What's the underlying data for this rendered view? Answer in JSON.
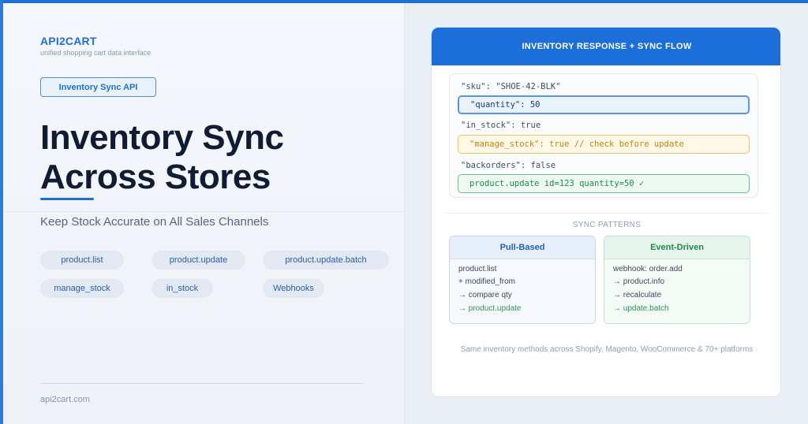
{
  "brand": {
    "name": "API2CART",
    "tagline": "unified shopping cart data interface"
  },
  "badge": "Inventory Sync API",
  "headline": {
    "line1": "Inventory Sync",
    "line2": "Across Stores"
  },
  "subtitle": "Keep Stock Accurate on All Sales Channels",
  "methods": [
    "product.list",
    "product.update",
    "product.update.batch",
    "manage_stock",
    "in_stock",
    "Webhooks"
  ],
  "footer_url": "api2cart.com",
  "card": {
    "title": "INVENTORY RESPONSE + SYNC FLOW",
    "code": {
      "sku": "\"sku\": \"SHOE-42-BLK\"",
      "quantity": "\"quantity\": 50",
      "in_stock": "\"in_stock\": true",
      "manage_stock": "\"manage_stock\": true // check before update",
      "backorders": "\"backorders\": false",
      "update_call": "product.update id=123 quantity=50 ✓"
    },
    "patterns_title": "SYNC PATTERNS",
    "patterns": [
      {
        "title": "Pull-Based",
        "lines": [
          "product.list",
          "+ modified_from",
          "→ compare qty",
          "→ product.update"
        ]
      },
      {
        "title": "Event-Driven",
        "lines": [
          "webhook: order.add",
          "→ product.info",
          "→ recalculate",
          "→ update.batch"
        ]
      }
    ],
    "footer": "Same inventory methods across Shopify, Magento, WooCommerce & 70+ platforms"
  },
  "colors": {
    "accent": "#1f6fd6",
    "heading": "#0f1c33",
    "success": "#1f8a4c",
    "warning": "#c08310"
  }
}
